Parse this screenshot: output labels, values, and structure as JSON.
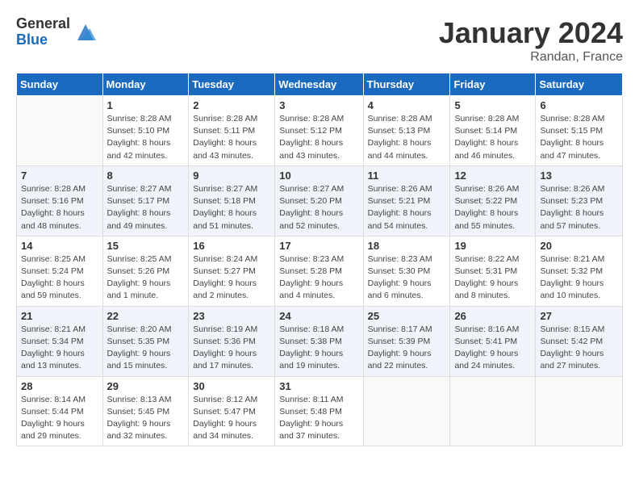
{
  "header": {
    "logo_general": "General",
    "logo_blue": "Blue",
    "month_title": "January 2024",
    "location": "Randan, France"
  },
  "weekdays": [
    "Sunday",
    "Monday",
    "Tuesday",
    "Wednesday",
    "Thursday",
    "Friday",
    "Saturday"
  ],
  "weeks": [
    [
      {
        "day": "",
        "sunrise": "",
        "sunset": "",
        "daylight": ""
      },
      {
        "day": "1",
        "sunrise": "Sunrise: 8:28 AM",
        "sunset": "Sunset: 5:10 PM",
        "daylight": "Daylight: 8 hours and 42 minutes."
      },
      {
        "day": "2",
        "sunrise": "Sunrise: 8:28 AM",
        "sunset": "Sunset: 5:11 PM",
        "daylight": "Daylight: 8 hours and 43 minutes."
      },
      {
        "day": "3",
        "sunrise": "Sunrise: 8:28 AM",
        "sunset": "Sunset: 5:12 PM",
        "daylight": "Daylight: 8 hours and 43 minutes."
      },
      {
        "day": "4",
        "sunrise": "Sunrise: 8:28 AM",
        "sunset": "Sunset: 5:13 PM",
        "daylight": "Daylight: 8 hours and 44 minutes."
      },
      {
        "day": "5",
        "sunrise": "Sunrise: 8:28 AM",
        "sunset": "Sunset: 5:14 PM",
        "daylight": "Daylight: 8 hours and 46 minutes."
      },
      {
        "day": "6",
        "sunrise": "Sunrise: 8:28 AM",
        "sunset": "Sunset: 5:15 PM",
        "daylight": "Daylight: 8 hours and 47 minutes."
      }
    ],
    [
      {
        "day": "7",
        "sunrise": "Sunrise: 8:28 AM",
        "sunset": "Sunset: 5:16 PM",
        "daylight": "Daylight: 8 hours and 48 minutes."
      },
      {
        "day": "8",
        "sunrise": "Sunrise: 8:27 AM",
        "sunset": "Sunset: 5:17 PM",
        "daylight": "Daylight: 8 hours and 49 minutes."
      },
      {
        "day": "9",
        "sunrise": "Sunrise: 8:27 AM",
        "sunset": "Sunset: 5:18 PM",
        "daylight": "Daylight: 8 hours and 51 minutes."
      },
      {
        "day": "10",
        "sunrise": "Sunrise: 8:27 AM",
        "sunset": "Sunset: 5:20 PM",
        "daylight": "Daylight: 8 hours and 52 minutes."
      },
      {
        "day": "11",
        "sunrise": "Sunrise: 8:26 AM",
        "sunset": "Sunset: 5:21 PM",
        "daylight": "Daylight: 8 hours and 54 minutes."
      },
      {
        "day": "12",
        "sunrise": "Sunrise: 8:26 AM",
        "sunset": "Sunset: 5:22 PM",
        "daylight": "Daylight: 8 hours and 55 minutes."
      },
      {
        "day": "13",
        "sunrise": "Sunrise: 8:26 AM",
        "sunset": "Sunset: 5:23 PM",
        "daylight": "Daylight: 8 hours and 57 minutes."
      }
    ],
    [
      {
        "day": "14",
        "sunrise": "Sunrise: 8:25 AM",
        "sunset": "Sunset: 5:24 PM",
        "daylight": "Daylight: 8 hours and 59 minutes."
      },
      {
        "day": "15",
        "sunrise": "Sunrise: 8:25 AM",
        "sunset": "Sunset: 5:26 PM",
        "daylight": "Daylight: 9 hours and 1 minute."
      },
      {
        "day": "16",
        "sunrise": "Sunrise: 8:24 AM",
        "sunset": "Sunset: 5:27 PM",
        "daylight": "Daylight: 9 hours and 2 minutes."
      },
      {
        "day": "17",
        "sunrise": "Sunrise: 8:23 AM",
        "sunset": "Sunset: 5:28 PM",
        "daylight": "Daylight: 9 hours and 4 minutes."
      },
      {
        "day": "18",
        "sunrise": "Sunrise: 8:23 AM",
        "sunset": "Sunset: 5:30 PM",
        "daylight": "Daylight: 9 hours and 6 minutes."
      },
      {
        "day": "19",
        "sunrise": "Sunrise: 8:22 AM",
        "sunset": "Sunset: 5:31 PM",
        "daylight": "Daylight: 9 hours and 8 minutes."
      },
      {
        "day": "20",
        "sunrise": "Sunrise: 8:21 AM",
        "sunset": "Sunset: 5:32 PM",
        "daylight": "Daylight: 9 hours and 10 minutes."
      }
    ],
    [
      {
        "day": "21",
        "sunrise": "Sunrise: 8:21 AM",
        "sunset": "Sunset: 5:34 PM",
        "daylight": "Daylight: 9 hours and 13 minutes."
      },
      {
        "day": "22",
        "sunrise": "Sunrise: 8:20 AM",
        "sunset": "Sunset: 5:35 PM",
        "daylight": "Daylight: 9 hours and 15 minutes."
      },
      {
        "day": "23",
        "sunrise": "Sunrise: 8:19 AM",
        "sunset": "Sunset: 5:36 PM",
        "daylight": "Daylight: 9 hours and 17 minutes."
      },
      {
        "day": "24",
        "sunrise": "Sunrise: 8:18 AM",
        "sunset": "Sunset: 5:38 PM",
        "daylight": "Daylight: 9 hours and 19 minutes."
      },
      {
        "day": "25",
        "sunrise": "Sunrise: 8:17 AM",
        "sunset": "Sunset: 5:39 PM",
        "daylight": "Daylight: 9 hours and 22 minutes."
      },
      {
        "day": "26",
        "sunrise": "Sunrise: 8:16 AM",
        "sunset": "Sunset: 5:41 PM",
        "daylight": "Daylight: 9 hours and 24 minutes."
      },
      {
        "day": "27",
        "sunrise": "Sunrise: 8:15 AM",
        "sunset": "Sunset: 5:42 PM",
        "daylight": "Daylight: 9 hours and 27 minutes."
      }
    ],
    [
      {
        "day": "28",
        "sunrise": "Sunrise: 8:14 AM",
        "sunset": "Sunset: 5:44 PM",
        "daylight": "Daylight: 9 hours and 29 minutes."
      },
      {
        "day": "29",
        "sunrise": "Sunrise: 8:13 AM",
        "sunset": "Sunset: 5:45 PM",
        "daylight": "Daylight: 9 hours and 32 minutes."
      },
      {
        "day": "30",
        "sunrise": "Sunrise: 8:12 AM",
        "sunset": "Sunset: 5:47 PM",
        "daylight": "Daylight: 9 hours and 34 minutes."
      },
      {
        "day": "31",
        "sunrise": "Sunrise: 8:11 AM",
        "sunset": "Sunset: 5:48 PM",
        "daylight": "Daylight: 9 hours and 37 minutes."
      },
      {
        "day": "",
        "sunrise": "",
        "sunset": "",
        "daylight": ""
      },
      {
        "day": "",
        "sunrise": "",
        "sunset": "",
        "daylight": ""
      },
      {
        "day": "",
        "sunrise": "",
        "sunset": "",
        "daylight": ""
      }
    ]
  ]
}
